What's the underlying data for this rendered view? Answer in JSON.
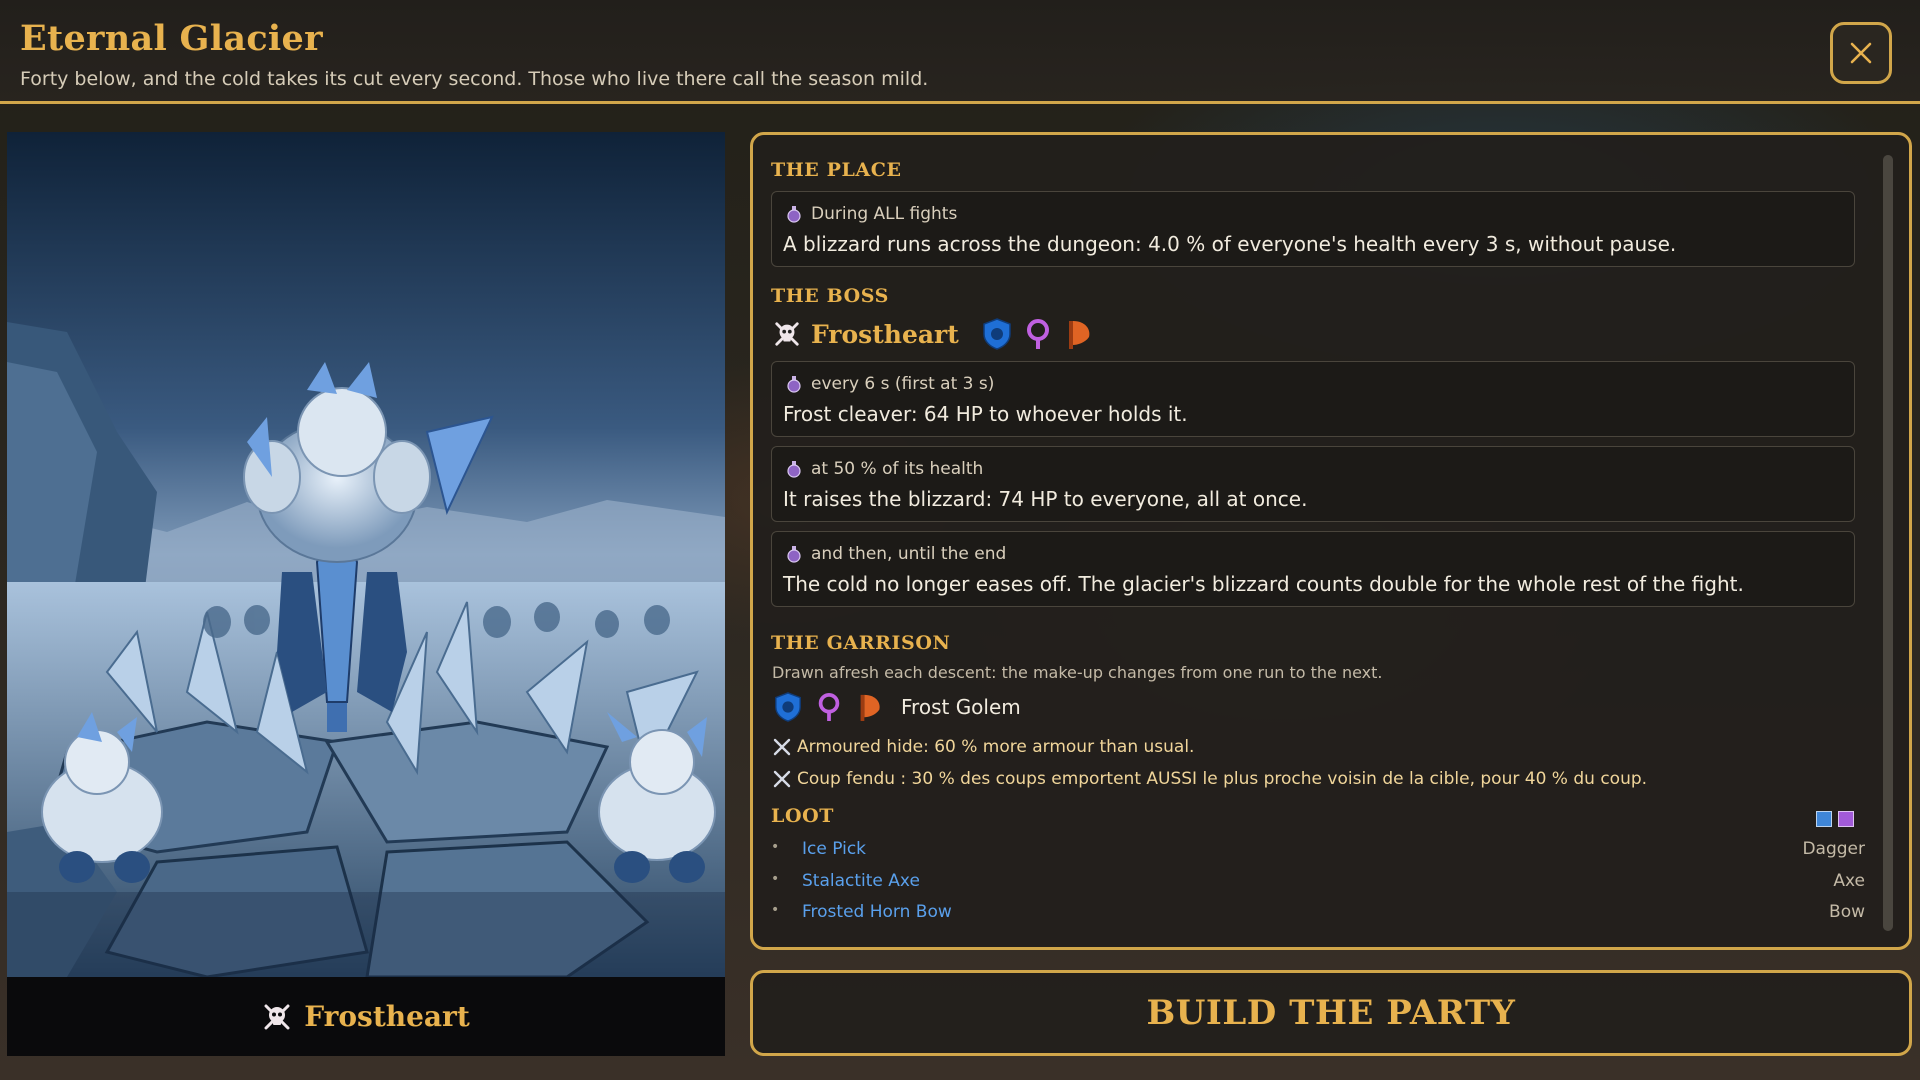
{
  "header": {
    "title": "Eternal Glacier",
    "subtitle": "Forty below, and the cold takes its cut every second. Those who live there call the season mild."
  },
  "image_panel": {
    "caption": "Frostheart"
  },
  "place": {
    "heading": "THE PLACE",
    "effect": {
      "trigger": "During ALL fights",
      "text": "A blizzard runs across the dungeon: 4.0 % of everyone's health every 3 s, without pause."
    }
  },
  "boss": {
    "heading": "THE BOSS",
    "name": "Frostheart",
    "icons": [
      "shield-icon",
      "ring-icon",
      "axe-icon"
    ],
    "effects": [
      {
        "trigger": "every 6 s (first at 3 s)",
        "text": "Frost cleaver: 64 HP to whoever holds it."
      },
      {
        "trigger": "at 50 % of its health",
        "text": "It raises the blizzard: 74 HP to everyone, all at once."
      },
      {
        "trigger": "and then, until the end",
        "text": "The cold no longer eases off. The glacier's blizzard counts double for the whole rest of the fight."
      }
    ]
  },
  "garrison": {
    "heading": "THE GARRISON",
    "note": "Drawn afresh each descent: the make-up changes from one run to the next.",
    "enemy": {
      "name": "Frost Golem",
      "icons": [
        "shield-icon",
        "ring-icon",
        "axe-icon"
      ]
    },
    "traits": [
      "Armoured hide: 60 % more armour than usual.",
      "Coup fendu : 30 % des coups emportent AUSSI le plus proche voisin de la cible, pour 40 % du coup."
    ]
  },
  "loot": {
    "heading": "LOOT",
    "rarity_colors": [
      "#3f86d8",
      "#a25ad8"
    ],
    "items": [
      {
        "bullet": "•",
        "name": "Ice Pick",
        "type": "Dagger"
      },
      {
        "bullet": "•",
        "name": "Stalactite Axe",
        "type": "Axe"
      },
      {
        "bullet": "•",
        "name": "Frosted Horn Bow",
        "type": "Bow"
      }
    ]
  },
  "actions": {
    "build_label": "BUILD THE PARTY"
  },
  "colors": {
    "accent": "#e8b24e",
    "border": "#d1a64a",
    "loot_link": "#5aa0ec",
    "trait_text": "#f0d59a"
  }
}
